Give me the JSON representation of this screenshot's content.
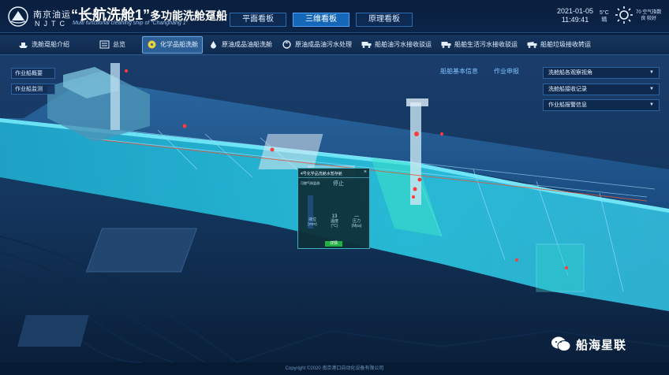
{
  "header": {
    "logo_cn": "南京油运",
    "logo_en": "NJTC",
    "title_quoted": "“长航洗舱1”",
    "title_suffix": "多功能洗舱趸船",
    "subtitle": "Multi functional cleaning ship of  “Changhang 1”",
    "tabs": [
      {
        "label": "平面看板",
        "active": false
      },
      {
        "label": "三维看板",
        "active": true
      },
      {
        "label": "原理看板",
        "active": false
      }
    ],
    "date": "2021-01-05",
    "time": "11:49:41",
    "temperature": "5°C",
    "weather_text": "晴",
    "aqi_value": "70 空气指数",
    "aqi_level": "良 较好"
  },
  "nav": {
    "items": [
      {
        "label": "洗舱趸船介绍",
        "icon": "ship-icon",
        "active": false
      },
      {
        "label": "总览",
        "icon": "list-icon",
        "active": false
      },
      {
        "label": "化学品船洗舱",
        "icon": "hazard-icon",
        "active": true
      },
      {
        "label": "原油成品油船洗舱",
        "icon": "oil-drop-icon",
        "active": false
      },
      {
        "label": "原油成品油污水处理",
        "icon": "recycle-icon",
        "active": false
      },
      {
        "label": "船舶油污水接收驳运",
        "icon": "truck-icon",
        "active": false
      },
      {
        "label": "船舶生活污水接收驳运",
        "icon": "truck-icon",
        "active": false
      },
      {
        "label": "船舶垃圾接收转运",
        "icon": "garbage-truck-icon",
        "active": false
      }
    ]
  },
  "left_panel": {
    "buttons": [
      "作业船概要",
      "作业船监测"
    ]
  },
  "center_links": {
    "ship_info": "船舶基本信息",
    "work_apply": "作业申报"
  },
  "right_panel": {
    "dropdowns": [
      "洗舱船各观察视角",
      "洗舱船接收记录",
      "作业船报警信息"
    ]
  },
  "popup": {
    "title": "4号化学品洗舱水暂存舱",
    "close": "×",
    "gas_label": "可燃气体监测:",
    "gas_value": "停止",
    "metrics": [
      {
        "value": "",
        "label": "液位",
        "unit": "(mm)"
      },
      {
        "value": "13",
        "label": "温度",
        "unit": "(°C)"
      },
      {
        "value": "—",
        "label": "压力",
        "unit": "(Mpa)"
      }
    ],
    "detail_button": "详情"
  },
  "footer": {
    "copyright": "Copyright ©2020 南京港口自动化设备有限公司"
  },
  "watermark": {
    "text": "船海星联"
  },
  "colors": {
    "accent": "#1567b8",
    "background": "#061a33",
    "tank_water": "#27d6e8",
    "detail_button": "#23b043",
    "alarm": "#ff3b3b"
  }
}
